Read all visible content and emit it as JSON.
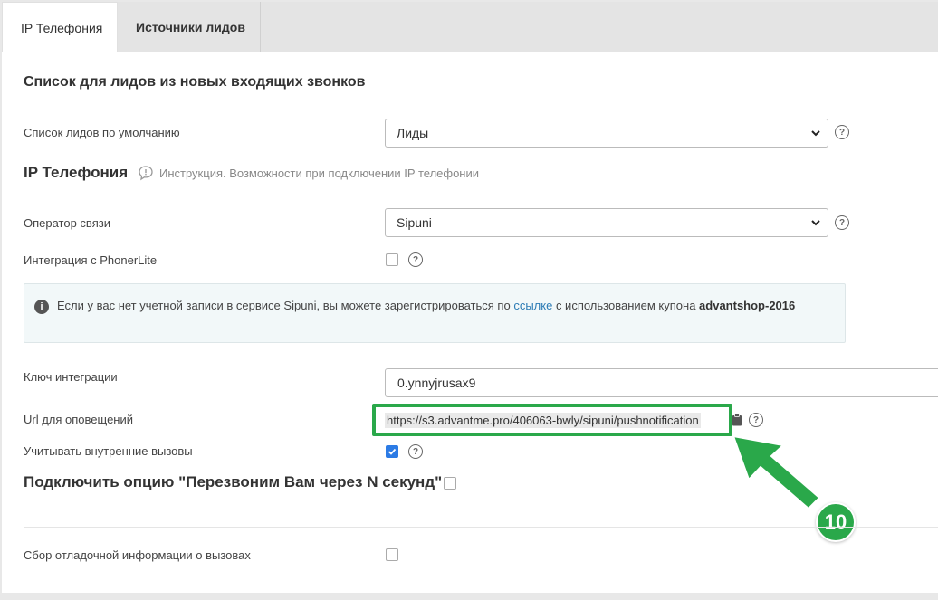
{
  "tabs": [
    {
      "label": "IP Телефония",
      "active": true
    },
    {
      "label": "Источники лидов",
      "active": false
    }
  ],
  "section_title": "Список для лидов из новых входящих звонков",
  "default_list": {
    "label": "Список лидов по умолчанию",
    "value": "Лиды"
  },
  "ip_section": {
    "title": "IP Телефония",
    "instruction": "Инструкция. Возможности при подключении IP телефонии"
  },
  "operator": {
    "label": "Оператор связи",
    "value": "Sipuni"
  },
  "phonerlite": {
    "label": "Интеграция с PhonerLite",
    "checked": false
  },
  "info": {
    "text_before": "Если у вас нет учетной записи в сервисе Sipuni, вы можете зарегистрироваться по ",
    "link": "ссылке",
    "text_after": " с использованием купона ",
    "coupon": "advantshop-2016"
  },
  "integration_key": {
    "label": "Ключ интеграции",
    "value": "0.ynnyjrusax9"
  },
  "notify_url": {
    "label": "Url для оповещений",
    "value": "https://s3.advantme.pro/406063-bwly/sipuni/pushnotification"
  },
  "internal_calls": {
    "label": "Учитывать внутренние вызовы",
    "checked": true
  },
  "callback_option": {
    "label": "Подключить опцию \"Перезвоним Вам через N секунд\"",
    "checked": false
  },
  "debug_info": {
    "label": "Сбор отладочной информации о вызовах",
    "checked": false
  },
  "annotation": {
    "number": "10",
    "color": "#2aa84a"
  },
  "help_glyph": "?",
  "info_glyph": "i"
}
